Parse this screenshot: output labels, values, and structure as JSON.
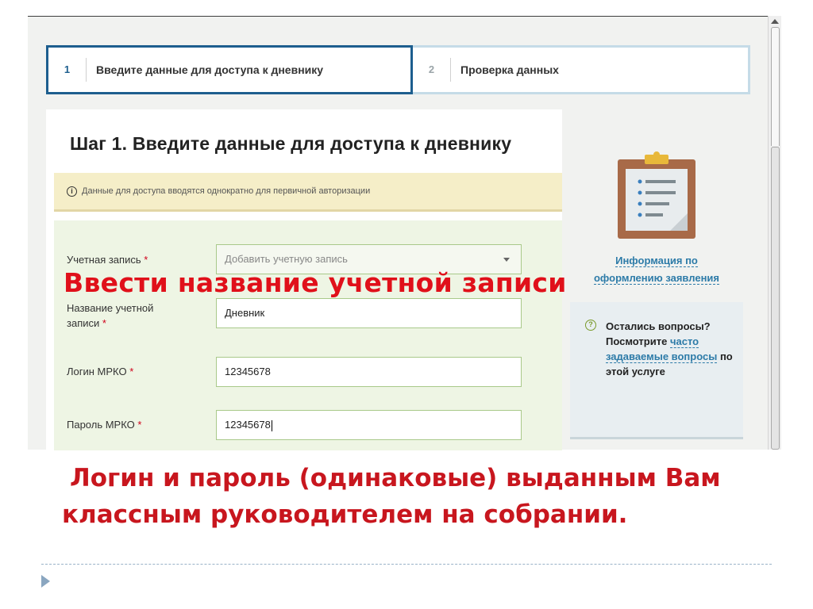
{
  "steps": [
    {
      "num": "1",
      "label": "Введите данные для доступа к дневнику"
    },
    {
      "num": "2",
      "label": "Проверка данных"
    }
  ],
  "main": {
    "title": "Шаг 1. Введите данные для доступа к дневнику",
    "notice": "Данные для доступа вводятся однократно для первичной авторизации"
  },
  "form": {
    "account": {
      "label": "Учетная запись",
      "required_mark": "*",
      "value": "Добавить учетную запись"
    },
    "account_name": {
      "label_line1": "Название учетной",
      "label_line2": "записи",
      "required_mark": "*",
      "value": "Дневник"
    },
    "login": {
      "label": "Логин МРКО",
      "required_mark": "*",
      "value": "12345678"
    },
    "password": {
      "label": "Пароль МРКО",
      "required_mark": "*",
      "value": "12345678"
    }
  },
  "sidebar": {
    "info_link_line1": "Информация по",
    "info_link_line2": "оформлению заявления",
    "faq_prefix": "Остались вопросы? Посмотрите",
    "faq_link": "часто задаваемые вопросы",
    "faq_suffix": "по этой услуге"
  },
  "captions": {
    "account_hint": "Ввести название учетной записи",
    "login_hint_line1": "Логин и пароль (одинаковые) выданным Вам",
    "login_hint_line2": "классным руководителем на собрании."
  },
  "icons": {
    "info": "info-icon",
    "question": "question-icon",
    "clipboard": "clipboard-icon",
    "bullet": "triangle-bullet-icon"
  },
  "colors": {
    "accent_blue": "#1d5e8e",
    "link_blue": "#2d7ba8",
    "caption_red": "#e0101a",
    "form_bg": "#eef5e4",
    "notice_bg": "#f5eec8"
  }
}
